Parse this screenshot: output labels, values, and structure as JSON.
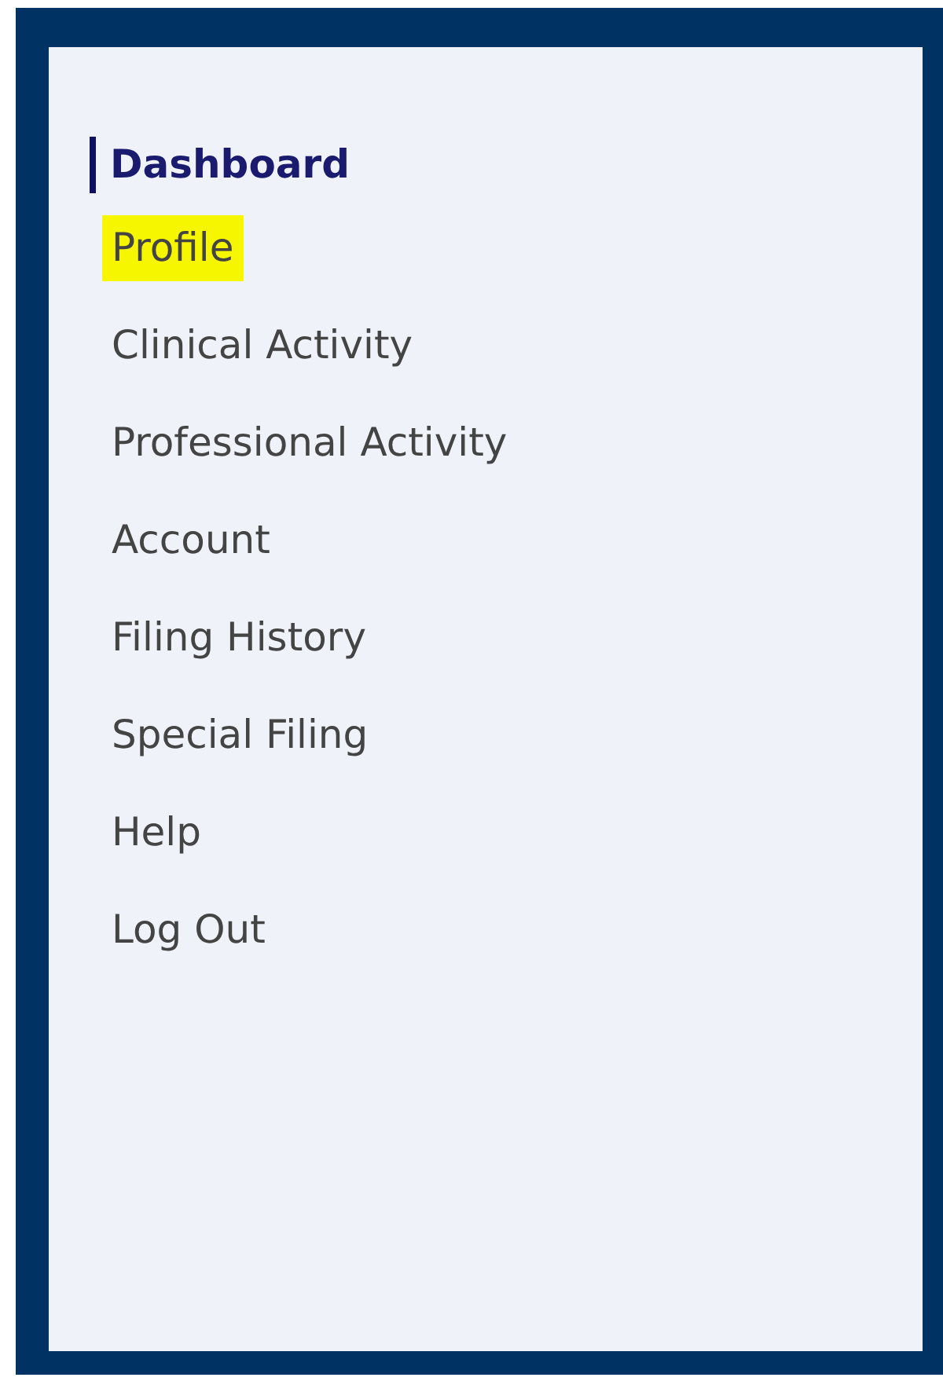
{
  "heading": "Dashboard",
  "menu": [
    {
      "label": "Profile",
      "selected": true
    },
    {
      "label": "Clinical Activity",
      "selected": false
    },
    {
      "label": "Professional Activity",
      "selected": false
    },
    {
      "label": "Account",
      "selected": false
    },
    {
      "label": "Filing History",
      "selected": false
    },
    {
      "label": "Special Filing",
      "selected": false
    },
    {
      "label": "Help",
      "selected": false
    },
    {
      "label": "Log Out",
      "selected": false
    }
  ]
}
